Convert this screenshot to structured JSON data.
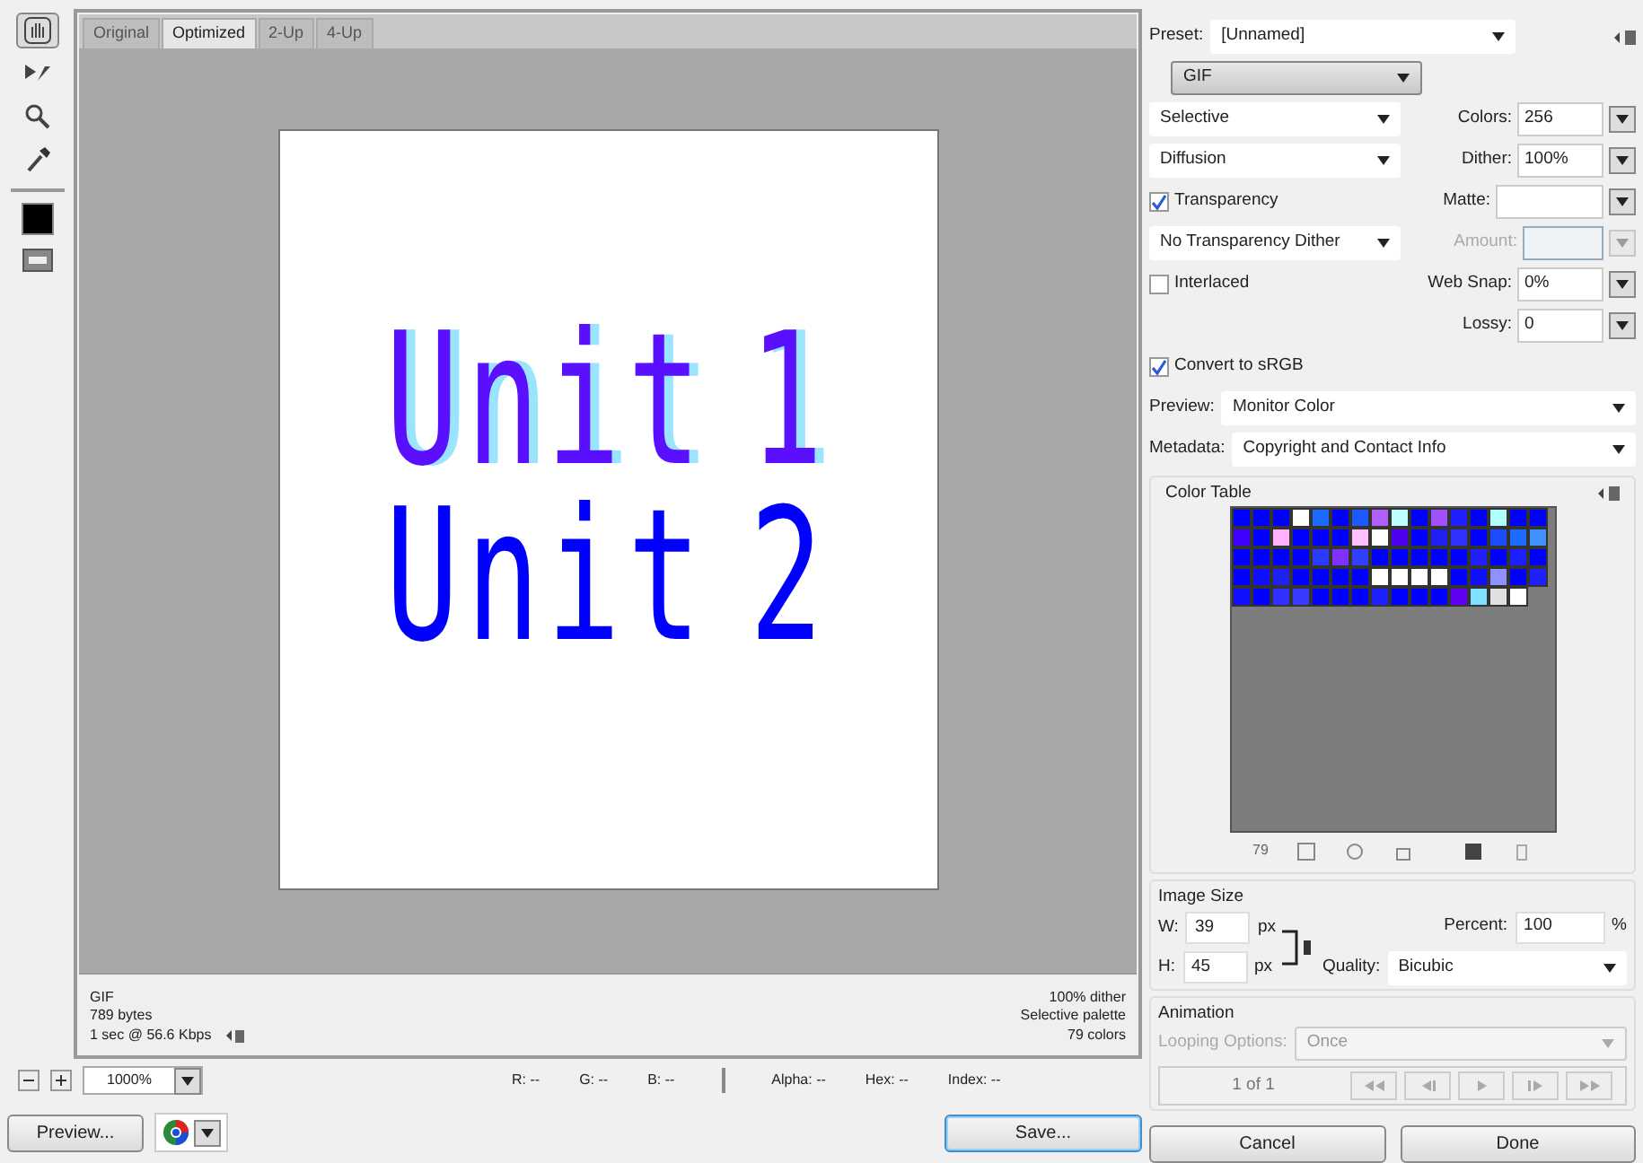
{
  "tools": [
    {
      "selected": true
    },
    {
      "selected": false
    },
    {
      "selected": false
    },
    {
      "selected": false
    }
  ],
  "tabs": [
    {
      "label": "Original",
      "selected": false
    },
    {
      "label": "Optimized",
      "selected": true
    },
    {
      "label": "2-Up",
      "selected": false
    },
    {
      "label": "4-Up",
      "selected": false
    }
  ],
  "preview": {
    "lines": [
      {
        "text": "Unit 1",
        "dithered": true
      },
      {
        "text": "Unit 2",
        "dithered": false
      }
    ]
  },
  "info": {
    "left": [
      "GIF",
      "789 bytes",
      "1 sec @ 56.6 Kbps"
    ],
    "right": [
      "100% dither",
      "Selective palette",
      "79 colors"
    ]
  },
  "zoom": {
    "value": "1000%"
  },
  "readouts": [
    [
      "R: --",
      "G: --",
      "B: --"
    ],
    [
      "Alpha: --",
      "Hex: --",
      "Index: --"
    ]
  ],
  "preview_button": "Preview...",
  "buttons": [
    {
      "label": "Save...",
      "default": true
    },
    {
      "label": "Cancel",
      "default": false
    },
    {
      "label": "Done",
      "default": false
    }
  ],
  "preset": {
    "label": "Preset:",
    "value": "[Unnamed]"
  },
  "format": "GIF",
  "reduction": "Selective",
  "colors": {
    "label": "Colors:",
    "value": "256"
  },
  "dither_algorithm": "Diffusion",
  "dither": {
    "label": "Dither:",
    "value": "100%"
  },
  "transparency": {
    "label": "Transparency",
    "checked": true
  },
  "matte": {
    "label": "Matte:"
  },
  "transparency_dither": "No Transparency Dither",
  "amount": {
    "label": "Amount:",
    "disabled": true
  },
  "interlaced": {
    "label": "Interlaced",
    "checked": false
  },
  "web_snap": {
    "label": "Web Snap:",
    "value": "0%"
  },
  "lossy": {
    "label": "Lossy:",
    "value": "0"
  },
  "convert_srgb": {
    "label": "Convert to sRGB",
    "checked": true
  },
  "preview_mode": {
    "label": "Preview:",
    "value": "Monitor Color"
  },
  "metadata": {
    "label": "Metadata:",
    "value": "Copyright and Contact Info"
  },
  "color_table": {
    "title": "Color Table",
    "count": "79",
    "swatches": [
      {
        "color": "#0000ff"
      },
      {
        "color": "#0000ff"
      },
      {
        "color": "#0000ff"
      },
      {
        "color": "#ffffff"
      },
      {
        "color": "#1e6cff"
      },
      {
        "color": "#0000ff"
      },
      {
        "color": "#1e5aff"
      },
      {
        "color": "#b060ff"
      },
      {
        "color": "#c0ffff"
      },
      {
        "color": "#0000ff"
      },
      {
        "color": "#a050ff"
      },
      {
        "color": "#2020ff"
      },
      {
        "color": "#0000ff"
      },
      {
        "color": "#b0ffff"
      },
      {
        "color": "#0000ff"
      },
      {
        "color": "#0000ff"
      },
      {
        "color": "#4000ff"
      },
      {
        "color": "#0000ff"
      },
      {
        "color": "#ffb0ff"
      },
      {
        "color": "#0000ff"
      },
      {
        "color": "#0000ff"
      },
      {
        "color": "#0000ff"
      },
      {
        "color": "#ffc0ff"
      },
      {
        "color": "#ffffff"
      },
      {
        "color": "#5000f0"
      },
      {
        "color": "#0000ff"
      },
      {
        "color": "#2020f0"
      },
      {
        "color": "#3030ff"
      },
      {
        "color": "#0000ff"
      },
      {
        "color": "#1a4dff"
      },
      {
        "color": "#1e6cff"
      },
      {
        "color": "#4090ff"
      },
      {
        "color": "#0000ff"
      },
      {
        "color": "#0000ff"
      },
      {
        "color": "#0000ff"
      },
      {
        "color": "#0000ff"
      },
      {
        "color": "#2a3cff"
      },
      {
        "color": "#8030ff"
      },
      {
        "color": "#3040ff"
      },
      {
        "color": "#0000ff"
      },
      {
        "color": "#0000ff"
      },
      {
        "color": "#0000ff"
      },
      {
        "color": "#0000ff"
      },
      {
        "color": "#0000ff"
      },
      {
        "color": "#2020ff"
      },
      {
        "color": "#0000ff"
      },
      {
        "color": "#1a20ff"
      },
      {
        "color": "#0000ff"
      },
      {
        "color": "#0000ff"
      },
      {
        "color": "#1010ff"
      },
      {
        "color": "#2020f0"
      },
      {
        "color": "#0000ff"
      },
      {
        "color": "#0000ff"
      },
      {
        "color": "#0000ff"
      },
      {
        "color": "#0000ff"
      },
      {
        "color": "#ffffff"
      },
      {
        "color": "#ffffff"
      },
      {
        "color": "#ffffff"
      },
      {
        "color": "#ffffff"
      },
      {
        "color": "#0000ff"
      },
      {
        "color": "#1010ff"
      },
      {
        "color": "#9090ff"
      },
      {
        "color": "#0000ff"
      },
      {
        "color": "#2020ff"
      },
      {
        "color": "#1010ff"
      },
      {
        "color": "#0000ff"
      },
      {
        "color": "#3030ff"
      },
      {
        "color": "#3a3aff"
      },
      {
        "color": "#0000ff"
      },
      {
        "color": "#0000ff"
      },
      {
        "color": "#0000ff"
      },
      {
        "color": "#2020ff"
      },
      {
        "color": "#0000ff"
      },
      {
        "color": "#0000ff"
      },
      {
        "color": "#0000ff"
      },
      {
        "color": "#6000f0"
      },
      {
        "color": "#80e0ff"
      },
      {
        "color": "#e0e0e0"
      },
      {
        "color": "#ffffff"
      }
    ]
  },
  "image_size": {
    "title": "Image Size",
    "width": {
      "label": "W:",
      "value": "39",
      "unit": "px"
    },
    "height": {
      "label": "H:",
      "value": "45",
      "unit": "px"
    },
    "percent": {
      "label": "Percent:",
      "value": "100",
      "unit": "%"
    },
    "quality": {
      "label": "Quality:",
      "value": "Bicubic"
    }
  },
  "animation": {
    "title": "Animation",
    "looping": {
      "label": "Looping Options:",
      "value": "Once",
      "disabled": true
    },
    "frame": "1 of 1"
  }
}
